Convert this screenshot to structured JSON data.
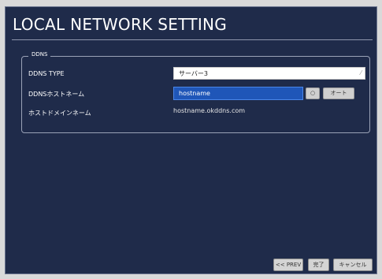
{
  "window": {
    "title": "LOCAL NETWORK SETTING"
  },
  "ddns": {
    "legend": "DDNS",
    "type_label": "DDNS TYPE",
    "type_value": "サーバー3",
    "hostname_label": "DDNSホストネーム",
    "hostname_value": "hostname",
    "check_button_label": "○",
    "auto_button_label": "オート",
    "domain_label": "ホストドメインネーム",
    "domain_value": "hostname.okddns.com"
  },
  "footer": {
    "prev_label": "<< PREV",
    "done_label": "完了",
    "cancel_label": "キャンセル"
  }
}
